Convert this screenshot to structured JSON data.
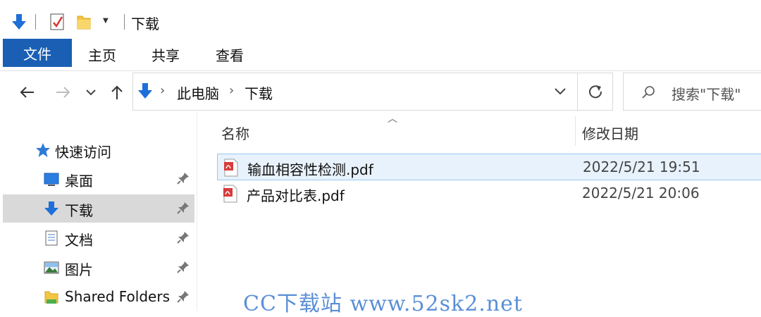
{
  "window": {
    "title": "下载"
  },
  "ribbon": {
    "file_tab": "文件",
    "tabs": [
      "主页",
      "共享",
      "查看"
    ]
  },
  "nav": {
    "back_icon": "arrow-left-icon",
    "forward_icon": "arrow-right-icon",
    "recent_icon": "chevron-down-icon",
    "up_icon": "arrow-up-icon"
  },
  "address": {
    "crumbs": [
      "此电脑",
      "下载"
    ],
    "refresh_icon": "refresh-icon"
  },
  "search": {
    "placeholder": "搜索\"下载\""
  },
  "sidebar": {
    "quick_access": "快速访问",
    "items": [
      {
        "label": "桌面",
        "icon": "desktop-icon",
        "pinned": true,
        "selected": false
      },
      {
        "label": "下载",
        "icon": "download-icon",
        "pinned": true,
        "selected": true
      },
      {
        "label": "文档",
        "icon": "document-icon",
        "pinned": true,
        "selected": false
      },
      {
        "label": "图片",
        "icon": "picture-icon",
        "pinned": true,
        "selected": false
      },
      {
        "label": "Shared Folders",
        "icon": "shared-folder-icon",
        "pinned": true,
        "selected": false
      }
    ]
  },
  "columns": {
    "name": "名称",
    "modified": "修改日期"
  },
  "files": [
    {
      "name": "输血相容性检测.pdf",
      "modified": "2022/5/21 19:51",
      "hover": true
    },
    {
      "name": "产品对比表.pdf",
      "modified": "2022/5/21 20:06",
      "hover": false
    }
  ],
  "watermark": "CC下载站 www.52sk2.net",
  "colors": {
    "accent": "#1a5fb4",
    "pdf_red": "#d83b3b",
    "watermark": "#5b8fd6"
  }
}
